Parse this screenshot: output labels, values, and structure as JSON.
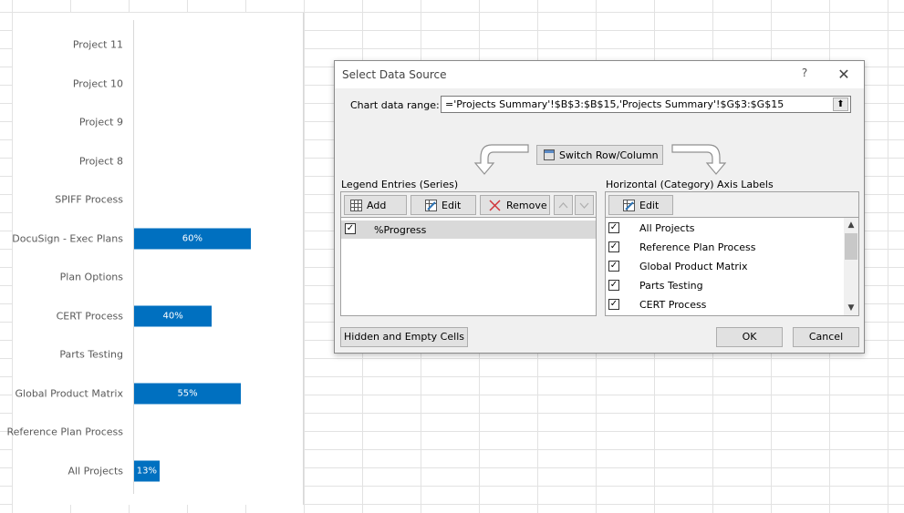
{
  "chart": {
    "categories": [
      "Project 11",
      "Project 10",
      "Project 9",
      "Project 8",
      "SPIFF Process",
      "DocuSign - Exec Plans",
      "Plan Options",
      "CERT Process",
      "Parts Testing",
      "Global Product Matrix",
      "Reference Plan Process",
      "All Projects"
    ],
    "values": [
      null,
      null,
      null,
      null,
      null,
      0.6,
      null,
      0.4,
      null,
      0.55,
      null,
      0.13
    ],
    "data_labels": [
      "",
      "",
      "",
      "",
      "",
      "60%",
      "",
      "40%",
      "",
      "55%",
      "",
      "13%"
    ],
    "bar_color": "#0070c0"
  },
  "dialog": {
    "title": "Select Data Source",
    "help": "?",
    "close": "✕",
    "range_label": "Chart data range:",
    "range_value": "='Projects Summary'!$B$3:$B$15,'Projects Summary'!$G$3:$G$15",
    "collapse_icon": "⬆",
    "switch_label": "Switch Row/Column",
    "legend_label": "Legend Entries (Series)",
    "legend_buttons": {
      "add": "Add",
      "edit": "Edit",
      "remove": "Remove"
    },
    "legend_items": [
      {
        "label": "%Progress",
        "checked": true
      }
    ],
    "axis_label": "Horizontal (Category) Axis Labels",
    "axis_edit": "Edit",
    "axis_items": [
      {
        "label": "All Projects",
        "checked": true
      },
      {
        "label": "Reference Plan Process",
        "checked": true
      },
      {
        "label": "Global Product Matrix",
        "checked": true
      },
      {
        "label": "Parts Testing",
        "checked": true
      },
      {
        "label": "CERT Process",
        "checked": true
      }
    ],
    "hidden_cells": "Hidden and Empty Cells",
    "ok": "OK",
    "cancel": "Cancel"
  }
}
